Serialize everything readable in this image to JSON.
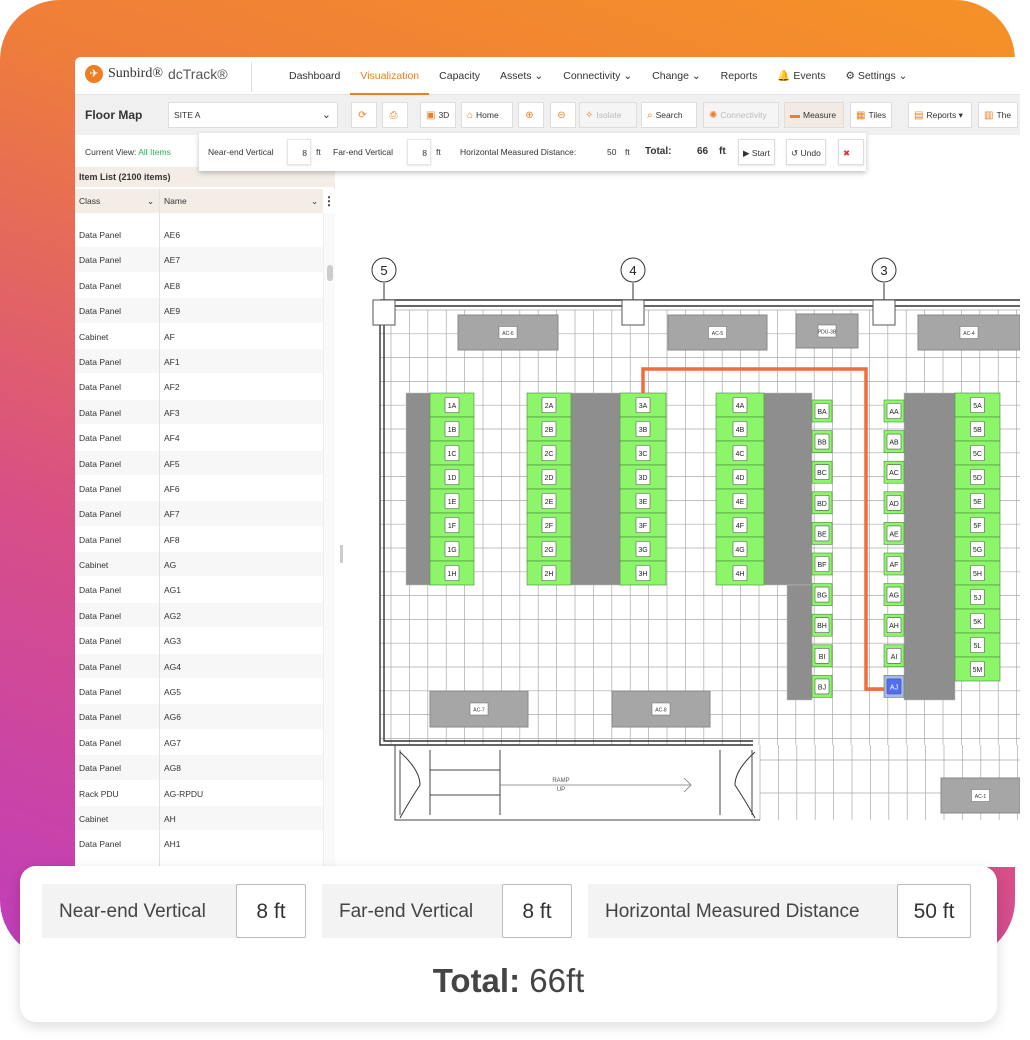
{
  "app": {
    "brand": "Sunbird®",
    "product": "dcTrack®",
    "accent": "#ef7d22"
  },
  "nav": [
    {
      "label": "Dashboard"
    },
    {
      "label": "Visualization",
      "active": true
    },
    {
      "label": "Capacity"
    },
    {
      "label": "Assets ⌄"
    },
    {
      "label": "Connectivity ⌄"
    },
    {
      "label": "Change ⌄"
    },
    {
      "label": "Reports"
    },
    {
      "label": "🔔 Events"
    },
    {
      "label": "⚙ Settings ⌄"
    }
  ],
  "toolbar": {
    "title": "Floor Map",
    "site": "SITE A",
    "buttons": [
      {
        "label": "",
        "icon": "⟳",
        "name": "refresh"
      },
      {
        "label": "",
        "icon": "⎙",
        "name": "print"
      },
      {
        "label": "3D",
        "icon": "▣",
        "name": "3d"
      },
      {
        "label": "Home",
        "icon": "⌂",
        "name": "home"
      },
      {
        "label": "",
        "icon": "⊕",
        "name": "zoom-in"
      },
      {
        "label": "",
        "icon": "⊖",
        "name": "zoom-out"
      },
      {
        "label": "Isolate",
        "icon": "✧",
        "name": "isolate",
        "disabled": true
      },
      {
        "label": "Search",
        "icon": "⌕",
        "name": "search"
      },
      {
        "label": "Connectivity",
        "icon": "✺",
        "name": "connectivity",
        "disabled": true
      },
      {
        "label": "Measure",
        "icon": "▬",
        "name": "measure",
        "pressed": true
      },
      {
        "label": "Tiles",
        "icon": "▦",
        "name": "tiles"
      },
      {
        "label": "Reports ▾",
        "icon": "▤",
        "name": "reports"
      },
      {
        "label": "The",
        "icon": "▥",
        "name": "themes"
      }
    ]
  },
  "current_view": {
    "label": "Current View:",
    "value": "All Items"
  },
  "item_list": {
    "title": "Item List (2100 items)",
    "columns": [
      "Class",
      "Name"
    ],
    "rows": [
      [
        "Data Panel",
        "AE6"
      ],
      [
        "Data Panel",
        "AE7"
      ],
      [
        "Data Panel",
        "AE8"
      ],
      [
        "Data Panel",
        "AE9"
      ],
      [
        "Cabinet",
        "AF"
      ],
      [
        "Data Panel",
        "AF1"
      ],
      [
        "Data Panel",
        "AF2"
      ],
      [
        "Data Panel",
        "AF3"
      ],
      [
        "Data Panel",
        "AF4"
      ],
      [
        "Data Panel",
        "AF5"
      ],
      [
        "Data Panel",
        "AF6"
      ],
      [
        "Data Panel",
        "AF7"
      ],
      [
        "Data Panel",
        "AF8"
      ],
      [
        "Cabinet",
        "AG"
      ],
      [
        "Data Panel",
        "AG1"
      ],
      [
        "Data Panel",
        "AG2"
      ],
      [
        "Data Panel",
        "AG3"
      ],
      [
        "Data Panel",
        "AG4"
      ],
      [
        "Data Panel",
        "AG5"
      ],
      [
        "Data Panel",
        "AG6"
      ],
      [
        "Data Panel",
        "AG7"
      ],
      [
        "Data Panel",
        "AG8"
      ],
      [
        "Rack PDU",
        "AG-RPDU"
      ],
      [
        "Cabinet",
        "AH"
      ],
      [
        "Data Panel",
        "AH1"
      ]
    ]
  },
  "measure_bar": {
    "near_label": "Near-end Vertical",
    "near": "8",
    "far_label": "Far-end Vertical",
    "far": "8",
    "horiz_label": "Horizontal Measured Distance:",
    "horiz": "50",
    "unit": "ft",
    "total_label": "Total:",
    "total": "66",
    "start": "▶ Start",
    "undo": "↺ Undo",
    "close": "✖"
  },
  "map": {
    "columns": [
      "5",
      "4",
      "3"
    ],
    "row1": [
      "1A",
      "1B",
      "1C",
      "1D",
      "1E",
      "1F",
      "1G",
      "1H"
    ],
    "row2": [
      "2A",
      "2B",
      "2C",
      "2D",
      "2E",
      "2F",
      "2G",
      "2H"
    ],
    "row3": [
      "3A",
      "3B",
      "3C",
      "3D",
      "3E",
      "3F",
      "3G",
      "3H"
    ],
    "row4": [
      "4A",
      "4B",
      "4C",
      "4D",
      "4E",
      "4F",
      "4G",
      "4H"
    ],
    "rowB": [
      "BA",
      "BB",
      "BC",
      "BD",
      "BE",
      "BF",
      "BG",
      "BH",
      "BI",
      "BJ"
    ],
    "rowA": [
      "AA",
      "AB",
      "AC",
      "AD",
      "AE",
      "AF",
      "AG",
      "AH",
      "AI",
      "AJ"
    ],
    "row5": [
      "5A",
      "5B",
      "5C",
      "5D",
      "5E",
      "5F",
      "5G",
      "5H",
      "5J",
      "5K",
      "5L",
      "5M"
    ],
    "units": [
      "AC-6",
      "AC-5",
      "PDU-3B",
      "AC-4",
      "AC-7",
      "AC-8",
      "AC-1"
    ],
    "ramp": [
      "RAMP",
      "UP"
    ],
    "selected": "AJ",
    "rack_color": "#8cf56a",
    "path_color": "#f26b3a",
    "select_color": "#4f6ef5"
  },
  "summary": {
    "near_label": "Near-end Vertical",
    "near": "8 ft",
    "far_label": "Far-end Vertical",
    "far": "8 ft",
    "horiz_label": "Horizontal Measured Distance",
    "horiz": "50 ft",
    "total_label": "Total:",
    "total": "66ft"
  }
}
